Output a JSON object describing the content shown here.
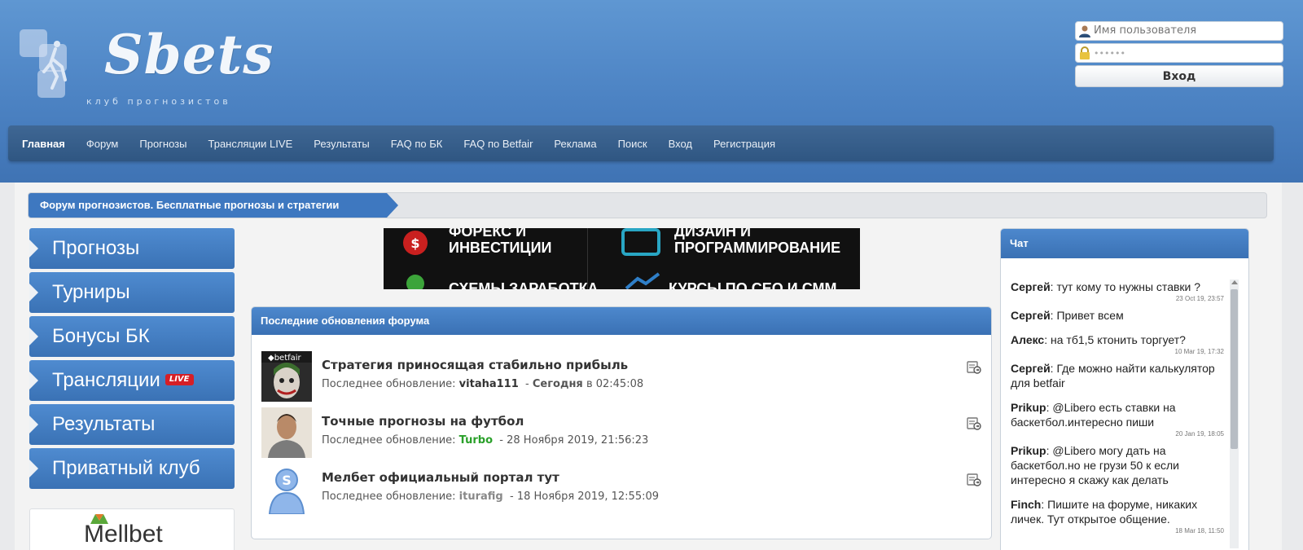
{
  "logo": {
    "wordmark": "Sbets",
    "tagline": "клуб прогнозистов"
  },
  "login": {
    "username_placeholder": "Имя пользователя",
    "password_value": "••••••",
    "submit_label": "Вход"
  },
  "nav": {
    "items": [
      {
        "label": "Главная",
        "active": true
      },
      {
        "label": "Форум"
      },
      {
        "label": "Прогнозы"
      },
      {
        "label": "Трансляции LIVE"
      },
      {
        "label": "Результаты"
      },
      {
        "label": "FAQ по БК"
      },
      {
        "label": "FAQ по Betfair"
      },
      {
        "label": "Реклама"
      },
      {
        "label": "Поиск"
      },
      {
        "label": "Вход"
      },
      {
        "label": "Регистрация"
      }
    ]
  },
  "breadcrumb": {
    "label": "Форум прогнозистов. Бесплатные прогнозы и стратегии"
  },
  "left_menu": {
    "items": [
      {
        "label": "Прогнозы"
      },
      {
        "label": "Турниры"
      },
      {
        "label": "Бонусы БК"
      },
      {
        "label": "Трансляции",
        "badge": "LIVE"
      },
      {
        "label": "Результаты"
      },
      {
        "label": "Приватный клуб"
      }
    ],
    "partner_logo": "Mellbet"
  },
  "banner": {
    "cells": [
      {
        "line1": "ФОРЕКС И",
        "line2": "ИНВЕСТИЦИИ"
      },
      {
        "line1": "ДИЗАЙН И",
        "line2": "ПРОГРАММИРОВАНИЕ"
      },
      {
        "line1": "СХЕМЫ ЗАРАБОТКА",
        "line2": ""
      },
      {
        "line1": "КУРСЫ ПО СЕО И СММ",
        "line2": ""
      }
    ]
  },
  "updates": {
    "title": "Последние обновления форума",
    "meta_prefix": "Последнее обновление:",
    "threads": [
      {
        "title": "Стратегия приносящая стабильно прибыль",
        "user": "vitaha111",
        "date_sep": "-",
        "date_bold": "Сегодня",
        "date_rest": "в 02:45:08",
        "avatar": "betfair"
      },
      {
        "title": "Точные прогнозы на футбол",
        "user": "Turbo",
        "date_sep": "-",
        "date_bold": "",
        "date_rest": "28 Ноября 2019, 21:56:23",
        "avatar": "photo"
      },
      {
        "title": "Мелбет официальный портал тут",
        "user": "iturafig",
        "date_sep": "-",
        "date_bold": "",
        "date_rest": "18 Ноября 2019, 12:55:09",
        "avatar": "default"
      }
    ]
  },
  "chat": {
    "title": "Чат",
    "messages": [
      {
        "who": "Сергей",
        "text": "тут кому то нужны ставки ?",
        "date": "23 Oct 19, 23:57"
      },
      {
        "who": "Сергей",
        "text": "Привет всем",
        "date": ""
      },
      {
        "who": "Алекс",
        "text": "на тб1,5 ктонить торгует?",
        "date": "10 Mar 19, 17:32"
      },
      {
        "who": "Сергей",
        "text": "Где можно найти калькулятор для betfair",
        "date": ""
      },
      {
        "who": "Prikup",
        "text": "@Libero есть ставки на баскетбол.интересно пиши",
        "date": "20 Jan 19, 18:05"
      },
      {
        "who": "Prikup",
        "text": "@Libero могу дать на баскетбол.но не грузи 50 к если интересно я скажу как делать",
        "date": ""
      },
      {
        "who": "Finch",
        "text": "Пишите на форуме, никаких личек. Тут открытое общение.",
        "date": "18 Mar 18, 11:50"
      }
    ]
  },
  "colors": {
    "header_blue": "#4f86c6",
    "nav_dark": "#2f5682",
    "menu_blue": "#3e78c0",
    "live_red": "#d61f26",
    "user_green": "#2aa02a"
  }
}
